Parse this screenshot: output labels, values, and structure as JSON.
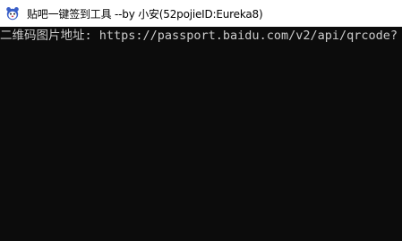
{
  "window": {
    "title": "贴吧一键签到工具 --by 小安(52pojieID:Eureka8)",
    "icon": "tieba-bear-icon"
  },
  "console": {
    "output_line": "二维码图片地址: https://passport.baidu.com/v2/api/qrcode?"
  },
  "colors": {
    "console_background": "#0c0c0c",
    "console_text": "#cccccc",
    "titlebar_background": "#ffffff"
  }
}
